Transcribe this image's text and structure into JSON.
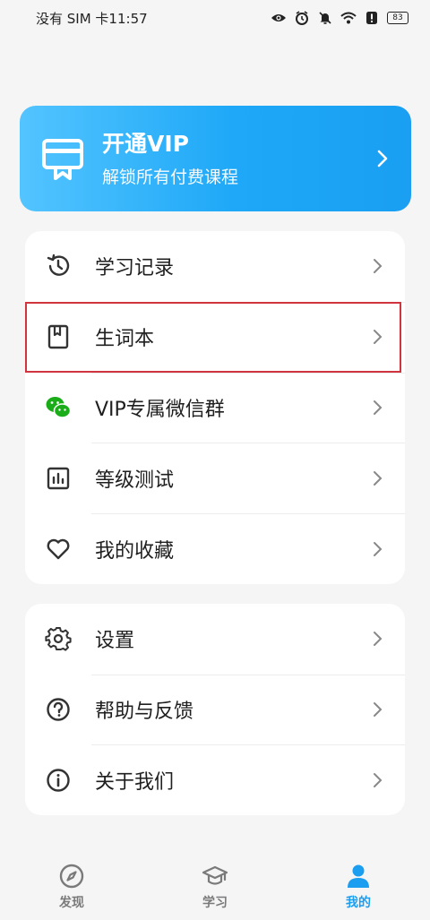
{
  "status_bar": {
    "carrier_time": "没有 SIM 卡11:57",
    "battery": "83",
    "icons": [
      "eye-icon",
      "alarm-icon",
      "mute-icon",
      "wifi-icon",
      "alert-icon",
      "battery-icon"
    ]
  },
  "vip_banner": {
    "title": "开通VIP",
    "subtitle": "解锁所有付费课程",
    "icon": "vip-card-icon",
    "color_start": "#53c4ff",
    "color_end": "#1a9ff2"
  },
  "menu_primary": [
    {
      "label": "学习记录",
      "icon": "history-icon"
    },
    {
      "label": "生词本",
      "icon": "wordbook-icon",
      "highlighted": true
    },
    {
      "label": "VIP专属微信群",
      "icon": "wechat-icon"
    },
    {
      "label": "等级测试",
      "icon": "chart-icon"
    },
    {
      "label": "我的收藏",
      "icon": "heart-icon"
    }
  ],
  "menu_secondary": [
    {
      "label": "设置",
      "icon": "gear-icon"
    },
    {
      "label": "帮助与反馈",
      "icon": "help-icon"
    },
    {
      "label": "关于我们",
      "icon": "info-icon"
    }
  ],
  "bottom_nav": [
    {
      "label": "发现",
      "icon": "compass-icon"
    },
    {
      "label": "学习",
      "icon": "graduation-cap-icon"
    },
    {
      "label": "我的",
      "icon": "person-icon",
      "active": true
    }
  ],
  "colors": {
    "accent": "#1b9ef0",
    "highlight_border": "#d0353f",
    "wechat_green": "#1aad19"
  }
}
